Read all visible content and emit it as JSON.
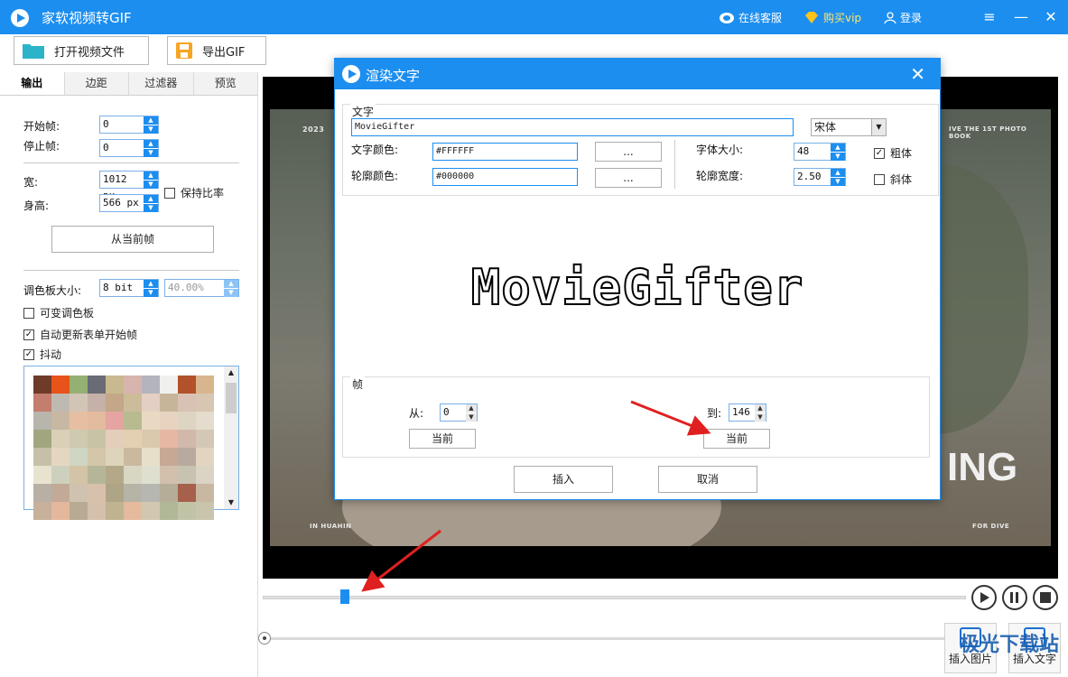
{
  "app": {
    "title": "家软视频转GIF"
  },
  "titlebar": {
    "service": "在线客服",
    "vip": "购买vip",
    "login": "登录"
  },
  "toolbar": {
    "open_video": "打开视频文件",
    "export_gif": "导出GIF"
  },
  "left": {
    "tabs": [
      {
        "label": "输出",
        "active": true
      },
      {
        "label": "边距",
        "active": false
      },
      {
        "label": "过滤器",
        "active": false
      },
      {
        "label": "预览",
        "active": false
      }
    ],
    "start_frame_label": "开始帧:",
    "start_frame_value": "0",
    "stop_frame_label": "停止帧:",
    "stop_frame_value": "0",
    "width_label": "宽:",
    "width_value": "1012 px",
    "height_label": "身高:",
    "height_value": "566 px",
    "keep_ratio_label": "保持比率",
    "keep_ratio_checked": false,
    "from_current_frame": "从当前帧",
    "palette_size_label": "调色板大小:",
    "palette_bits": "8 bit",
    "palette_percent": "40.00%",
    "variable_palette_label": "可变调色板",
    "auto_update_label": "自动更新表单开始帧",
    "dither_label": "抖动",
    "palette_colors": [
      "#6e3b28",
      "#e8531a",
      "#94b073",
      "#6a6b74",
      "#c9b98f",
      "#d8b4ae",
      "#b3b4bc",
      "#f0f0ee",
      "#b2522a",
      "#d9b58e",
      "#c37e6e",
      "#bfbab1",
      "#d3c5b6",
      "#c5b1a7",
      "#c4a788",
      "#ccbc9a",
      "#e3cfc4",
      "#c7b59a",
      "#d9c2b4",
      "#d7c6b1",
      "#b8b5ad",
      "#c8b8a3",
      "#e6bfa3",
      "#e3bb9f",
      "#e5a4a1",
      "#b7bb8f",
      "#ead9c2",
      "#e8d3c1",
      "#ddd5c1",
      "#e4dccc",
      "#a2a67f",
      "#d9d0b7",
      "#cfc9b0",
      "#c8c3a6",
      "#e3cdbb",
      "#e5cfb3",
      "#dbc9ad",
      "#e6b8a4",
      "#d1b8ab",
      "#d4c7b4",
      "#c6c0a8",
      "#e4d7c1",
      "#cfd6c3",
      "#d4c6a8",
      "#ded3bb",
      "#cbb99f",
      "#e8dfcb",
      "#c6a895",
      "#b8aa9f",
      "#e2d4bf",
      "#e8e3cf",
      "#cdd0bd",
      "#d3c3a7",
      "#b5b697",
      "#b3a988",
      "#d9d7c3",
      "#dfdfcf",
      "#d2c0ad",
      "#c7c3b0",
      "#dbd4c4",
      "#b8b0a4",
      "#c3a997",
      "#cfc2b1",
      "#d8c1ac",
      "#aea586",
      "#b5b4a6",
      "#b6b7b1",
      "#b5ad98",
      "#a6604b",
      "#c9b8a1",
      "#c7b19b",
      "#e3b89d",
      "#b8aa93",
      "#d4c0ab",
      "#bfb390",
      "#e5ba9d",
      "#d2c7b0",
      "#b1b897",
      "#c1c3a6",
      "#c9c5ad"
    ]
  },
  "dialog": {
    "title": "渲染文字",
    "text_group": "文字",
    "text_value": "MovieGifter",
    "font_name": "宋体",
    "text_color_label": "文字颜色:",
    "text_color_value": "#FFFFFF",
    "outline_color_label": "轮廓颜色:",
    "outline_color_value": "#000000",
    "ellipsis": "...",
    "font_size_label": "字体大小:",
    "font_size_value": "48",
    "outline_width_label": "轮廓宽度:",
    "outline_width_value": "2.50",
    "bold_label": "粗体",
    "bold_checked": true,
    "italic_label": "斜体",
    "italic_checked": false,
    "preview_text": "MovieGifter",
    "frame_group": "帧",
    "from_label": "从:",
    "from_value": "0",
    "to_label": "到:",
    "to_value": "146",
    "current_label": "当前",
    "insert_label": "插入",
    "cancel_label": "取消"
  },
  "video": {
    "photo_text_left": "2023",
    "photo_text_right": "IVE THE 1ST PHOTO BOOK",
    "photo_caption_left": "IN HUAHIN",
    "photo_caption_right": "FOR DIVE",
    "overlay_text": "ING",
    "seek_progress": 0.12
  },
  "bottom": {
    "insert_image": "插入图片",
    "insert_text": "插入文字"
  },
  "watermark": "极光下载站",
  "colors": {
    "accent": "#1c8ef0",
    "arrow": "#e02020"
  }
}
